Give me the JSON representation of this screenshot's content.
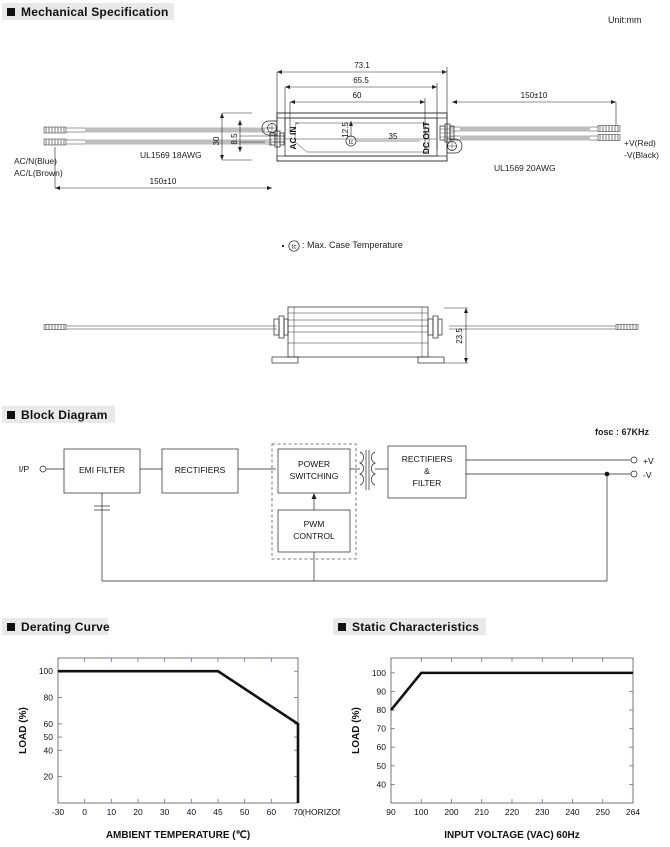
{
  "sections": {
    "mechanical": {
      "title": "Mechanical Specification",
      "unit_note": "Unit:mm"
    },
    "block": {
      "title": "Block Diagram",
      "fosc": "fosc : 67KHz"
    },
    "derating": {
      "title": "Derating Curve"
    },
    "static": {
      "title": "Static Characteristics"
    }
  },
  "mechanical": {
    "dims": {
      "d_731": "73.1",
      "d_655": "65.5",
      "d_60": "60",
      "d_150_right": "150±10",
      "d_150_left": "150±10",
      "d_30": "30",
      "d_85": "8.5",
      "d_125": "12.5",
      "d_35": "35",
      "d_235": "23.5"
    },
    "labels": {
      "ac_n": "AC/N(Blue)",
      "ac_l": "AC/L(Brown)",
      "wire_in": "UL1569  18AWG",
      "wire_out": "UL1569  20AWG",
      "v_pos": "+V(Red)",
      "v_neg": "-V(Black)",
      "ac_in": "AC  IN",
      "dc_out": "DC  OUT",
      "tc_marker": "tc"
    },
    "note": ": Max. Case Temperature"
  },
  "block_diagram": {
    "input_label": "I/P",
    "blocks": [
      {
        "id": "emi",
        "label": "EMI FILTER"
      },
      {
        "id": "rect1",
        "label": "RECTIFIERS"
      },
      {
        "id": "power",
        "label_line1": "POWER",
        "label_line2": "SWITCHING"
      },
      {
        "id": "rect2",
        "label_line1": "RECTIFIERS",
        "label_line2": "&",
        "label_line3": "FILTER"
      },
      {
        "id": "pwm",
        "label_line1": "PWM",
        "label_line2": "CONTROL"
      }
    ],
    "outputs": [
      {
        "label": "+V"
      },
      {
        "label": "-V"
      }
    ]
  },
  "chart_data": [
    {
      "type": "line",
      "id": "derating-curve",
      "title": "Derating Curve",
      "xlabel": "AMBIENT TEMPERATURE (℃)",
      "ylabel": "LOAD (%)",
      "note": "(HORIZONTAL)",
      "xticks": [
        -30,
        0,
        10,
        20,
        30,
        40,
        45,
        50,
        60,
        70
      ],
      "xticklabels": [
        "-30",
        "0",
        "10",
        "20",
        "30",
        "40",
        "45",
        "50",
        "60",
        "70"
      ],
      "yticks": [
        20,
        40,
        50,
        60,
        80,
        100
      ],
      "yticklabels": [
        "20",
        "40",
        "50",
        "60",
        "80",
        "100"
      ],
      "xlim": [
        -30,
        75
      ],
      "ylim": [
        0,
        110
      ],
      "grid": false,
      "x": [
        -30,
        45,
        70,
        70
      ],
      "values": [
        100,
        100,
        60,
        0
      ]
    },
    {
      "type": "line",
      "id": "static-characteristics",
      "title": "Static Characteristics",
      "xlabel": "INPUT VOLTAGE (VAC) 60Hz",
      "ylabel": "LOAD (%)",
      "xticks": [
        90,
        100,
        200,
        210,
        220,
        230,
        240,
        250,
        264
      ],
      "xticklabels": [
        "90",
        "100",
        "200",
        "210",
        "220",
        "230",
        "240",
        "250",
        "264"
      ],
      "yticks": [
        40,
        50,
        60,
        70,
        80,
        90,
        100
      ],
      "yticklabels": [
        "40",
        "50",
        "60",
        "70",
        "80",
        "90",
        "100"
      ],
      "xlim": [
        85,
        275
      ],
      "ylim": [
        30,
        108
      ],
      "grid": false,
      "x": [
        90,
        100,
        264
      ],
      "values": [
        80,
        100,
        100
      ]
    }
  ]
}
